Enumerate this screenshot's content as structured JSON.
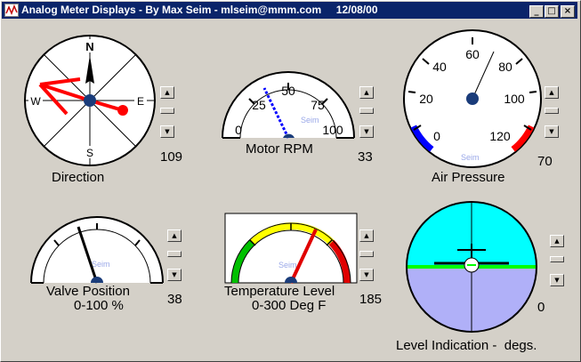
{
  "window": {
    "title": "Analog Meter Displays - By Max Seim - mlseim@mmm.com     12/08/00",
    "min_glyph": "_",
    "max_glyph": "□",
    "close_glyph": "×"
  },
  "watermark": "Seim",
  "gauges": {
    "direction": {
      "label": "Direction",
      "value": "109",
      "cardinals": {
        "n": "N",
        "e": "E",
        "s": "S",
        "w": "W"
      },
      "heading_deg": 109
    },
    "rpm": {
      "label": "Motor RPM",
      "value": "33",
      "scale": [
        "0",
        "25",
        "50",
        "75",
        "100"
      ],
      "level": 33
    },
    "pressure": {
      "label": "Air Pressure",
      "value": "70",
      "scale": [
        "0",
        "20",
        "40",
        "60",
        "80",
        "100",
        "120"
      ],
      "level": 70
    },
    "valve": {
      "label": "Valve Position",
      "sublabel": "0-100 %",
      "value": "38",
      "level": 38
    },
    "temp": {
      "label": "Temperature Level",
      "sublabel": "0-300 Deg F",
      "value": "185",
      "level": 185,
      "colors": {
        "low": "#00c000",
        "mid": "#ffff00",
        "high": "#e00000"
      }
    },
    "level": {
      "label": "Level Indication -  degs.",
      "value": "0",
      "colors": {
        "sky": "#00ffff",
        "ground": "#b0b0f8",
        "horizon": "#00ff00"
      }
    }
  },
  "spinners": {
    "up_glyph": "▲",
    "mid_glyph": "",
    "down_glyph": "▼"
  }
}
